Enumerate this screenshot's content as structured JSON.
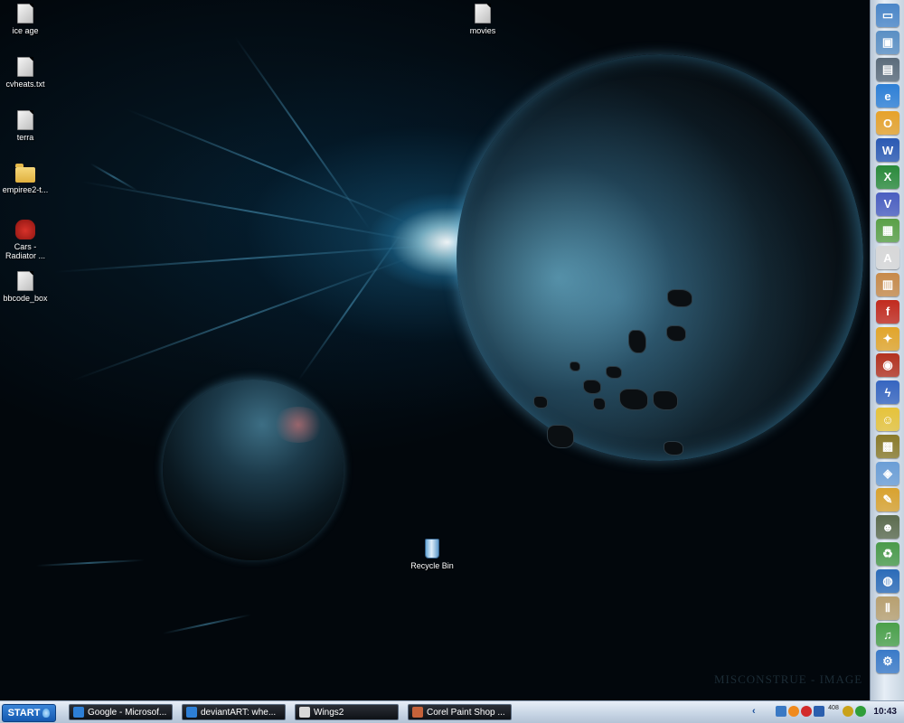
{
  "desktop": {
    "icons": [
      {
        "label": "ice age",
        "type": "file"
      },
      {
        "label": "cvheats.txt",
        "type": "file"
      },
      {
        "label": "terra",
        "type": "file"
      },
      {
        "label": "empiree2-t...",
        "type": "folder"
      },
      {
        "label": "Cars -\nRadiator ...",
        "type": "cars"
      },
      {
        "label": "bbcode_box",
        "type": "file"
      },
      {
        "label": "movies",
        "type": "file"
      },
      {
        "label": "Recycle Bin",
        "type": "recycle-bin"
      }
    ],
    "wallpaper_text": "MISCONSTRUE - IMAGE"
  },
  "dock": {
    "items": [
      {
        "name": "monitor-icon",
        "color": "#4a86c8",
        "glyph": "▭"
      },
      {
        "name": "computers-icon",
        "color": "#5a8fc4",
        "glyph": "▣"
      },
      {
        "name": "server-icon",
        "color": "#5b6b7a",
        "glyph": "▤"
      },
      {
        "name": "internet-explorer-icon",
        "color": "#2d7fd6",
        "glyph": "e"
      },
      {
        "name": "outlook-icon",
        "color": "#e6a22b",
        "glyph": "O"
      },
      {
        "name": "word-icon",
        "color": "#2a59b3",
        "glyph": "W"
      },
      {
        "name": "excel-icon",
        "color": "#2a8a3a",
        "glyph": "X"
      },
      {
        "name": "visio-icon",
        "color": "#4a5ec0",
        "glyph": "V"
      },
      {
        "name": "maps-icon",
        "color": "#5aa046",
        "glyph": "▦"
      },
      {
        "name": "acrobat-icon",
        "color": "#d8d8d8",
        "glyph": "A"
      },
      {
        "name": "installer-icon",
        "color": "#c78a4a",
        "glyph": "▥"
      },
      {
        "name": "flash-icon",
        "color": "#c22a1e",
        "glyph": "f"
      },
      {
        "name": "tools-icon",
        "color": "#e2a52a",
        "glyph": "✦"
      },
      {
        "name": "media-icon",
        "color": "#b3321f",
        "glyph": "◉"
      },
      {
        "name": "lightning-icon",
        "color": "#3665c0",
        "glyph": "ϟ"
      },
      {
        "name": "messenger-icon",
        "color": "#e6c33a",
        "glyph": "☺"
      },
      {
        "name": "film-icon",
        "color": "#8a7a2a",
        "glyph": "▩"
      },
      {
        "name": "network-icon",
        "color": "#6b9ed6",
        "glyph": "◈"
      },
      {
        "name": "pencil-icon",
        "color": "#d9a22e",
        "glyph": "✎"
      },
      {
        "name": "game-character-icon",
        "color": "#5c6b4e",
        "glyph": "☻"
      },
      {
        "name": "recycle-icon",
        "color": "#4a9a4a",
        "glyph": "♻"
      },
      {
        "name": "globe-icon",
        "color": "#2b6bb8",
        "glyph": "◍"
      },
      {
        "name": "empire-icon",
        "color": "#b8a070",
        "glyph": "Ⅱ"
      },
      {
        "name": "music-icon",
        "color": "#4aa04a",
        "glyph": "♫"
      },
      {
        "name": "tools2-icon",
        "color": "#3a7ac8",
        "glyph": "⚙"
      }
    ]
  },
  "taskbar": {
    "start_label": "START",
    "tasks": [
      {
        "label": "Google - Microsof...",
        "icon": "ie-icon",
        "color": "#2d7fd6"
      },
      {
        "label": "deviantART: whe...",
        "icon": "ie-icon",
        "color": "#2d7fd6"
      },
      {
        "label": "Wings2",
        "icon": "folder-icon",
        "color": "#d8d8d8"
      },
      {
        "label": "Corel Paint Shop ...",
        "icon": "paint-shop-icon",
        "color": "#c5623a"
      }
    ],
    "tray_badge": "408",
    "clock": "10:43"
  }
}
